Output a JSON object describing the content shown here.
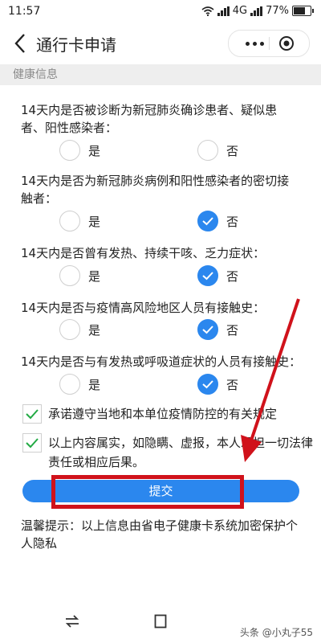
{
  "status": {
    "time": "11:57",
    "network": "4G",
    "battery": "77%",
    "battery_level": 0.77
  },
  "nav": {
    "title": "通行卡申请"
  },
  "section": {
    "title": "健康信息"
  },
  "questions": [
    {
      "text": "14天内是否被诊断为新冠肺炎确诊患者、疑似患者、阳性感染者：",
      "yes": "是",
      "no": "否",
      "selected": null
    },
    {
      "text": "14天内是否为新冠肺炎病例和阳性感染者的密切接触者：",
      "yes": "是",
      "no": "否",
      "selected": "no"
    },
    {
      "text": "14天内是否曾有发热、持续干咳、乏力症状：",
      "yes": "是",
      "no": "否",
      "selected": "no"
    },
    {
      "text": "14天内是否与疫情高风险地区人员有接触史：",
      "yes": "是",
      "no": "否",
      "selected": "no"
    },
    {
      "text": "14天内是否与有发热或呼吸道症状的人员有接触史：",
      "yes": "是",
      "no": "否",
      "selected": "no"
    }
  ],
  "checkboxes": [
    {
      "text": "承诺遵守当地和本单位疫情防控的有关规定",
      "checked": true
    },
    {
      "text": "以上内容属实，如隐瞒、虚报，本人承担一切法律责任或相应后果。",
      "checked": true
    }
  ],
  "submit": {
    "label": "提交"
  },
  "hint": {
    "text": "温馨提示：以上信息由省电子健康卡系统加密保护个人隐私"
  },
  "watermark": {
    "text": "头条 @小丸子55"
  },
  "colors": {
    "accent": "#2b87ee",
    "annotation": "#d0121b"
  }
}
